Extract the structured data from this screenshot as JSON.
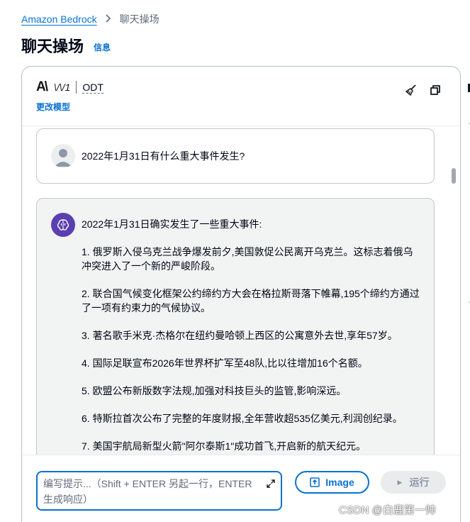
{
  "breadcrumb": {
    "root": "Amazon Bedrock",
    "separator": ">",
    "current": "聊天操场"
  },
  "page": {
    "title": "聊天操场",
    "info": "信息"
  },
  "model": {
    "glyph": "\\/\\/1",
    "name": "ODT",
    "change": "更改模型"
  },
  "conversation": {
    "user_message": "2022年1月31日有什么重大事件发生?",
    "assistant": {
      "intro": "2022年1月31日确实发生了一些重大事件:",
      "items": [
        "1. 俄罗斯入侵乌克兰战争爆发前夕,美国敦促公民离开乌克兰。这标志着俄乌冲突进入了一个新的严峻阶段。",
        "2. 联合国气候变化框架公约缔约方大会在格拉斯哥落下帷幕,195个缔约方通过了一项有约束力的气候协议。",
        "3. 著名歌手米克·杰格尔在纽约曼哈顿上西区的公寓意外去世,享年57岁。",
        "4. 国际足联宣布2026年世界杯扩军至48队,比以往增加16个名额。",
        "5. 欧盟公布新版数字法规,加强对科技巨头的监管,影响深远。",
        "6. 特斯拉首次公布了完整的年度财报,全年营收超535亿美元,利润创纪录。",
        "7. 美国宇航局新型火箭\"阿尔泰斯1\"成功首飞,开启新的航天纪元。"
      ]
    }
  },
  "composer": {
    "placeholder": "编写提示...（Shift + ENTER 另起一行，ENTER 生成响应）",
    "image_label": "Image",
    "run_label": "运行"
  },
  "watermark": "CSDN @白鹿第一帅",
  "colors": {
    "link": "#0972d3",
    "bot_avatar": "#5a3fb0",
    "bubble_bg": "#f2f3f3",
    "disabled": "#e9ebed"
  }
}
